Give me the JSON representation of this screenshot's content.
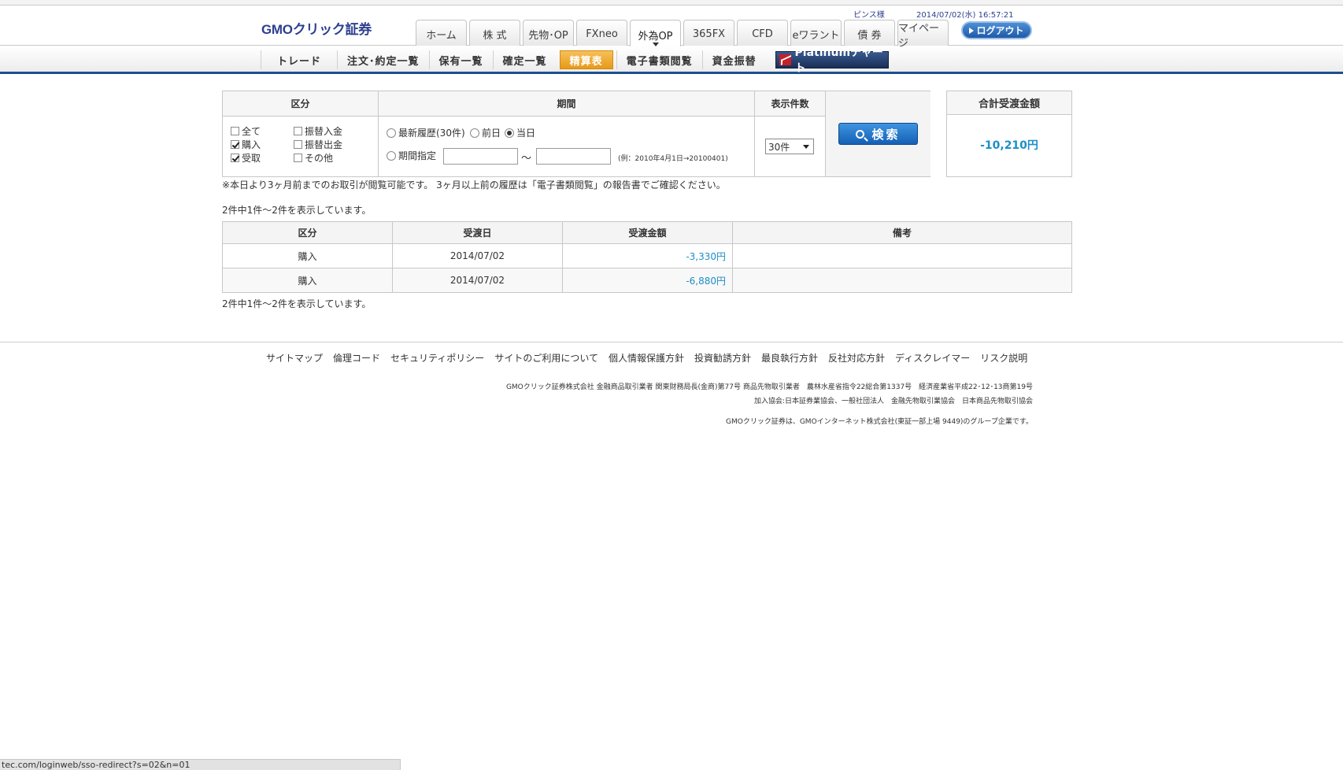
{
  "header": {
    "logo_text": "GMOクリック証券",
    "user": "ピンス様",
    "datetime": "2014/07/02(水) 16:57:21",
    "tabs": [
      "ホーム",
      "株 式",
      "先物･OP",
      "FXneo",
      "外為OP",
      "365FX",
      "CFD",
      "eワラント",
      "債 券",
      "マイページ"
    ],
    "active_tab": "外為OP",
    "logout_label": "ログアウト"
  },
  "subnav": {
    "items": [
      "トレード",
      "注文･約定一覧",
      "保有一覧",
      "確定一覧",
      "精算表",
      "電子書類閲覧",
      "資金振替"
    ],
    "active_item": "精算表",
    "platinum_label": "Platinumチャート"
  },
  "filter": {
    "kubun_header": "区分",
    "kikan_header": "期間",
    "count_header": "表示件数",
    "checkboxes": [
      {
        "label": "全て",
        "checked": false
      },
      {
        "label": "購入",
        "checked": true
      },
      {
        "label": "受取",
        "checked": true
      },
      {
        "label": "振替入金",
        "checked": false
      },
      {
        "label": "振替出金",
        "checked": false
      },
      {
        "label": "その他",
        "checked": false
      }
    ],
    "radios": [
      {
        "label": "最新履歴(30件)",
        "checked": false
      },
      {
        "label": "前日",
        "checked": false
      },
      {
        "label": "当日",
        "checked": true
      },
      {
        "label": "期間指定",
        "checked": false
      }
    ],
    "date_from": "",
    "date_to": "",
    "tilde": "～",
    "example": "(例：2010年4月1日→20100401)",
    "count_selected": "30件",
    "search_label": "検索"
  },
  "total": {
    "header": "合計受渡金額",
    "value": "-10,210円"
  },
  "note": "※本日より3ヶ月前までのお取引が閲覧可能です。 3ヶ月以上前の履歴は「電子書類閲覧」の報告書でご確認ください。",
  "count_text_top": "2件中1件～2件を表示しています。",
  "count_text_bottom": "2件中1件～2件を表示しています。",
  "table": {
    "headers": [
      "区分",
      "受渡日",
      "受渡金額",
      "備考"
    ],
    "rows": [
      {
        "kubun": "購入",
        "date": "2014/07/02",
        "amount": "-3,330円",
        "note": ""
      },
      {
        "kubun": "購入",
        "date": "2014/07/02",
        "amount": "-6,880円",
        "note": ""
      }
    ]
  },
  "footer": {
    "links": [
      "サイトマップ",
      "倫理コード",
      "セキュリティポリシー",
      "サイトのご利用について",
      "個人情報保護方針",
      "投資勧誘方針",
      "最良執行方針",
      "反社対応方針",
      "ディスクレイマー",
      "リスク説明"
    ],
    "legal1": "GMOクリック証券株式会社 金融商品取引業者 関東財務局長(金商)第77号 商品先物取引業者　農林水産省指令22総合第1337号　経済産業省平成22･12･13商第19号",
    "legal2": "加入協会:日本証券業協会、一般社団法人　金融先物取引業協会　日本商品先物取引協会",
    "legal3": "GMOクリック証券は、GMOインターネット株式会社(東証一部上場 9449)のグループ企業です。"
  },
  "statusbar": "tec.com/loginweb/sso-redirect?s=02&n=01",
  "colors": {
    "accent": "#1c4f8f",
    "amount": "#1d8fc7",
    "active_sub": "#e79a17"
  }
}
